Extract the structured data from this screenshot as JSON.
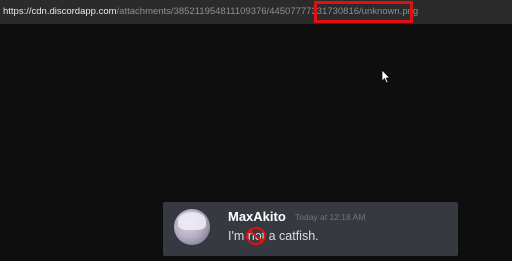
{
  "browser": {
    "url_host": "https://cdn.discordapp.com",
    "url_path": "/attachments/385211954811109376/445077773317308",
    "url_end": "16/unknown.png"
  },
  "message": {
    "username": "MaxAkito",
    "timestamp": "Today at 12:18 AM",
    "text_before": "I'm ",
    "struck_word": "not",
    "text_after": " a catfish."
  },
  "colors": {
    "highlight": "#e01010",
    "card_background": "#36393f",
    "page_background": "#0e0e0e"
  },
  "icons": {
    "cursor": "mouse-pointer-icon",
    "no_symbol": "prohibited-icon"
  }
}
